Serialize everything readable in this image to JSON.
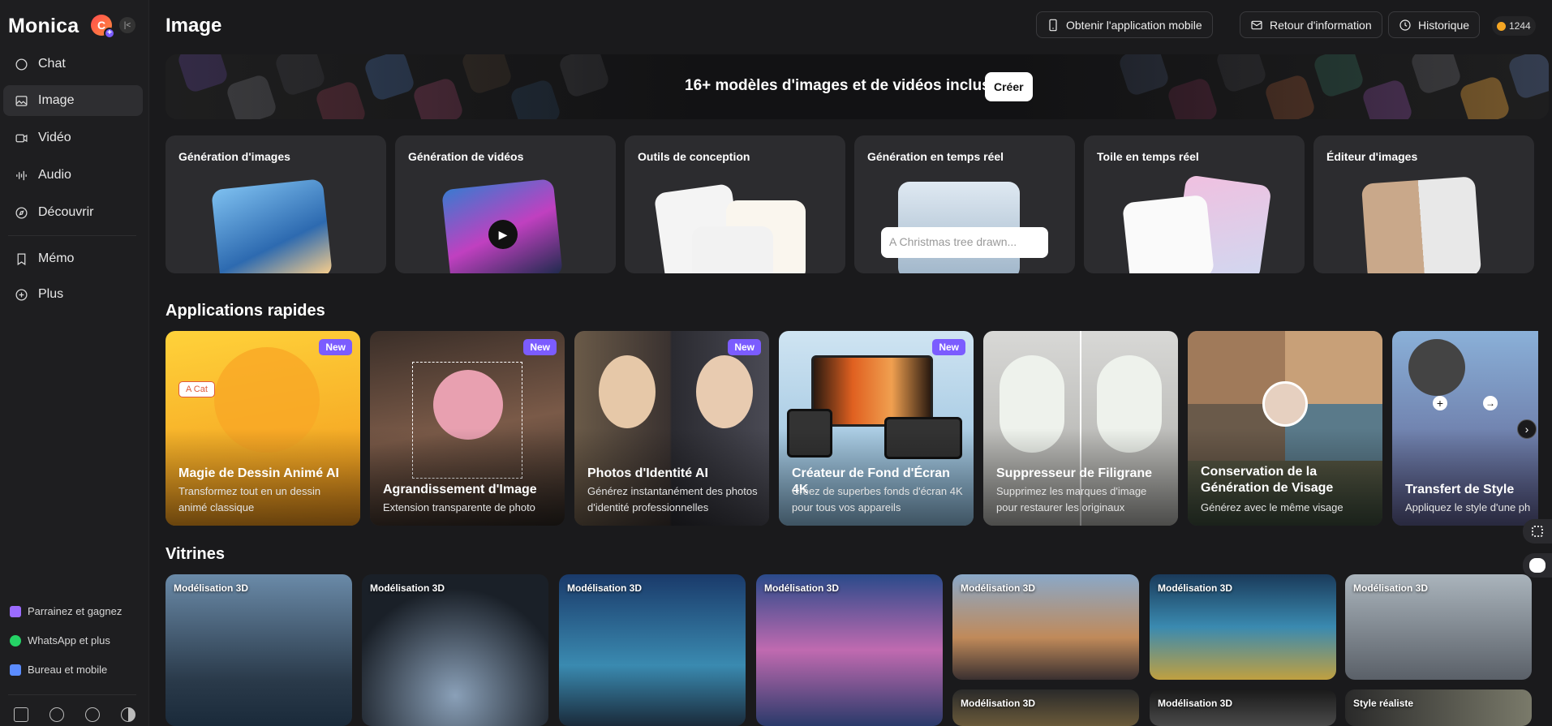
{
  "sidebar": {
    "brand": "Monica",
    "avatar_letter": "C",
    "nav": [
      {
        "label": "Chat",
        "icon": "chat-icon"
      },
      {
        "label": "Image",
        "icon": "image-icon",
        "active": true
      },
      {
        "label": "Vidéo",
        "icon": "video-icon"
      },
      {
        "label": "Audio",
        "icon": "audio-wave-icon"
      },
      {
        "label": "Découvrir",
        "icon": "compass-icon"
      },
      {
        "label": "Mémo",
        "icon": "bookmark-icon"
      },
      {
        "label": "Plus",
        "icon": "plus-circle-icon"
      }
    ],
    "footer": [
      {
        "label": "Parrainez et gagnez",
        "icon": "gift-icon",
        "color": "#9b6bff"
      },
      {
        "label": "WhatsApp et plus",
        "icon": "whatsapp-icon",
        "color": "#25d366"
      },
      {
        "label": "Bureau et mobile",
        "icon": "devices-icon",
        "color": "#5b8cff"
      }
    ],
    "bottom_icons": [
      "home-icon",
      "help-icon",
      "settings-icon",
      "theme-icon"
    ]
  },
  "header": {
    "title": "Image",
    "buttons": [
      {
        "label": "Obtenir l'application mobile",
        "icon": "phone-icon"
      },
      {
        "label": "Retour d'information",
        "icon": "mail-icon"
      },
      {
        "label": "Historique",
        "icon": "clock-icon"
      }
    ],
    "credits": "1244"
  },
  "banner": {
    "text": "16+ modèles d'images et de vidéos inclus",
    "button": "Créer"
  },
  "tools": [
    {
      "label": "Génération d'images"
    },
    {
      "label": "Génération de vidéos"
    },
    {
      "label": "Outils de conception"
    },
    {
      "label": "Génération en temps réel",
      "prompt": "A Christmas tree drawn..."
    },
    {
      "label": "Toile en temps réel"
    },
    {
      "label": "Éditeur d'images"
    }
  ],
  "quick_apps": {
    "title": "Applications rapides",
    "items": [
      {
        "title": "Magie de Dessin Animé AI",
        "desc": "Transformez tout en un dessin animé classique",
        "badge": "New",
        "tag": "A Cat"
      },
      {
        "title": "Agrandissement d'Image",
        "desc": "Extension transparente de photo",
        "badge": "New"
      },
      {
        "title": "Photos d'Identité AI",
        "desc": "Générez instantanément des photos d'identité professionnelles",
        "badge": "New"
      },
      {
        "title": "Créateur de Fond d'Écran 4K",
        "desc": "Créez de superbes fonds d'écran 4K pour tous vos appareils",
        "badge": "New"
      },
      {
        "title": "Suppresseur de Filigrane",
        "desc": "Supprimez les marques d'image pour restaurer les originaux"
      },
      {
        "title": "Conservation de la Génération de Visage",
        "desc": "Générez avec le même visage"
      },
      {
        "title": "Transfert de Style",
        "desc": "Appliquez le style d'une ph"
      }
    ]
  },
  "showcase": {
    "title": "Vitrines",
    "items": [
      {
        "label": "Modélisation 3D"
      },
      {
        "label": "Modélisation 3D"
      },
      {
        "label": "Modélisation 3D"
      },
      {
        "label": "Modélisation 3D"
      },
      {
        "label": "Modélisation 3D"
      },
      {
        "label": "Modélisation 3D"
      },
      {
        "label": "Modélisation 3D"
      },
      {
        "label": "Modélisation 3D"
      },
      {
        "label": "Modélisation 3D"
      },
      {
        "label": "Style réaliste"
      }
    ]
  }
}
